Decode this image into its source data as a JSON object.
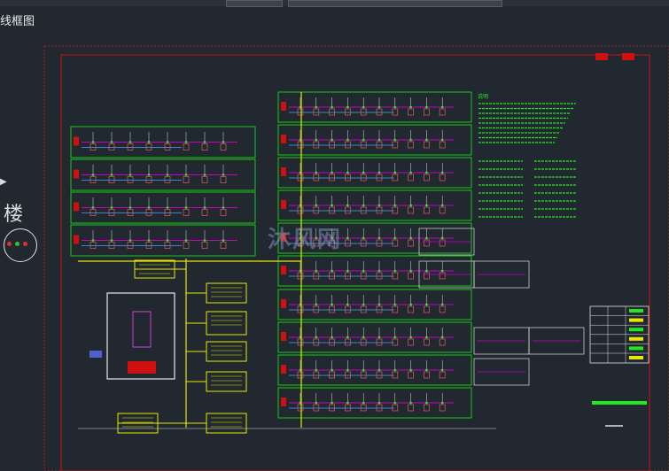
{
  "window": {
    "tab_title": "线框图",
    "toolbar_icons": [
      "new-icon",
      "open-icon",
      "save-icon",
      "undo-icon",
      "redo-icon",
      "layer-icon",
      "print-icon"
    ]
  },
  "sidebar": {
    "building_label": "楼"
  },
  "drawing": {
    "description_heading": "说明",
    "watermark": "沐风网",
    "colors": {
      "background": "#212830",
      "frame": "#d01010",
      "panel_border": "#19c819",
      "wire": "#e8e800",
      "circuit": "#c800c8",
      "text_green": "#22e822"
    }
  }
}
